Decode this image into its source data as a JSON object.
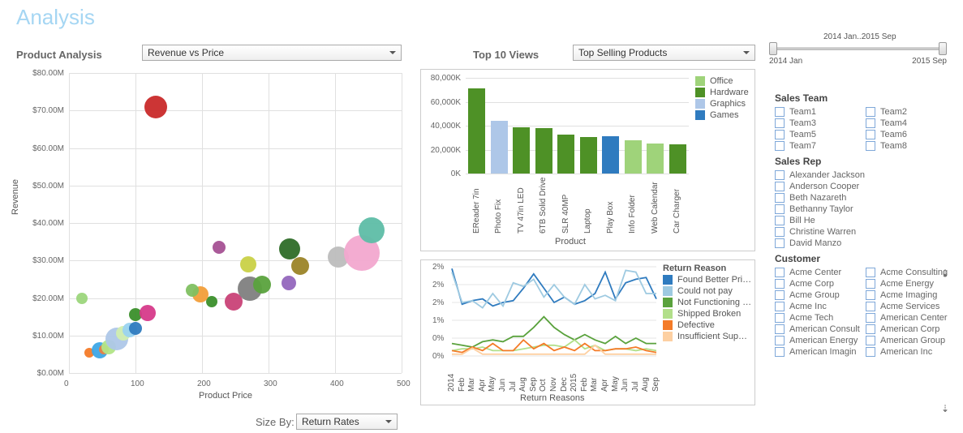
{
  "title": "Analysis",
  "dropdowns": {
    "product_analysis": {
      "label": "Product Analysis",
      "value": "Revenue vs Price"
    },
    "top10": {
      "label": "Top 10 Views",
      "value": "Top Selling Products"
    },
    "size_by": {
      "label": "Size By:",
      "value": "Return Rates"
    }
  },
  "chart_data": [
    {
      "id": "scatter",
      "type": "scatter",
      "title": "Revenue vs Price",
      "xlabel": "Product Price",
      "ylabel": "Revenue",
      "xlim": [
        0,
        500
      ],
      "ylim": [
        0,
        80
      ],
      "xticks": [
        0,
        100,
        200,
        300,
        400,
        500
      ],
      "yticks": [
        "$0.00M",
        "$10.00M",
        "$20.00M",
        "$30.00M",
        "$40.00M",
        "$50.00M",
        "$60.00M",
        "$70.00M",
        "$80.00M"
      ],
      "yvals": [
        0,
        10,
        20,
        30,
        40,
        50,
        60,
        70,
        80
      ],
      "bubbles": [
        {
          "x": 30,
          "y": 5.5,
          "r": 6,
          "c": "#f47b28"
        },
        {
          "x": 46,
          "y": 6.0,
          "r": 10,
          "c": "#3da6e6"
        },
        {
          "x": 52,
          "y": 6.3,
          "r": 6,
          "c": "#e87f43"
        },
        {
          "x": 60,
          "y": 7.0,
          "r": 9,
          "c": "#b2e587"
        },
        {
          "x": 72,
          "y": 9.0,
          "r": 14,
          "c": "#aec7e8"
        },
        {
          "x": 82,
          "y": 10.5,
          "r": 9,
          "c": "#d1edb0"
        },
        {
          "x": 92,
          "y": 11.5,
          "r": 9,
          "c": "#9ad3f0"
        },
        {
          "x": 100,
          "y": 12.0,
          "r": 8,
          "c": "#2f7bbf"
        },
        {
          "x": 100,
          "y": 15.5,
          "r": 8,
          "c": "#3b8f2b"
        },
        {
          "x": 20,
          "y": 20.0,
          "r": 7,
          "c": "#9cd67c"
        },
        {
          "x": 118,
          "y": 16.0,
          "r": 10,
          "c": "#d63a8a"
        },
        {
          "x": 130,
          "y": 71.0,
          "r": 14,
          "c": "#c92a2a"
        },
        {
          "x": 215,
          "y": 19.0,
          "r": 7,
          "c": "#3b8f2b"
        },
        {
          "x": 198,
          "y": 21.0,
          "r": 10,
          "c": "#f29e3a"
        },
        {
          "x": 185,
          "y": 22.0,
          "r": 8,
          "c": "#7fc061"
        },
        {
          "x": 226,
          "y": 33.5,
          "r": 8,
          "c": "#a55194"
        },
        {
          "x": 248,
          "y": 19.0,
          "r": 11,
          "c": "#c94277"
        },
        {
          "x": 272,
          "y": 22.5,
          "r": 15,
          "c": "#7f7f7f"
        },
        {
          "x": 270,
          "y": 29.0,
          "r": 10,
          "c": "#c9d147"
        },
        {
          "x": 290,
          "y": 23.5,
          "r": 11,
          "c": "#5aa23d"
        },
        {
          "x": 330,
          "y": 24.0,
          "r": 9,
          "c": "#9467bd"
        },
        {
          "x": 332,
          "y": 33.0,
          "r": 13,
          "c": "#2e6d28"
        },
        {
          "x": 348,
          "y": 28.5,
          "r": 11,
          "c": "#9b8428"
        },
        {
          "x": 405,
          "y": 31.0,
          "r": 13,
          "c": "#bdbdbd"
        },
        {
          "x": 440,
          "y": 32.0,
          "r": 22,
          "c": "#f2a8cf"
        },
        {
          "x": 455,
          "y": 38.0,
          "r": 16,
          "c": "#5ebda7"
        }
      ]
    },
    {
      "id": "top_products",
      "type": "bar",
      "xlabel": "Product",
      "categories": [
        "EReader 7in",
        "Photo Fix",
        "TV 47in LED",
        "6TB Solid Drive",
        "SLR 40MP",
        "Laptop",
        "Play Box",
        "Info Folder",
        "Web Calendar",
        "Car Charger"
      ],
      "values": [
        71000,
        44000,
        38500,
        38000,
        32500,
        30500,
        31000,
        27500,
        25000,
        24500
      ],
      "colors": [
        "#4e9126",
        "#aec7e8",
        "#4e9126",
        "#4e9126",
        "#4e9126",
        "#4e9126",
        "#2f7bbf",
        "#9fd37a",
        "#9fd37a",
        "#4e9126"
      ],
      "ylim": [
        0,
        80000
      ],
      "yticks": [
        "0K",
        "20,000K",
        "40,000K",
        "60,000K",
        "80,000K"
      ],
      "yvals": [
        0,
        20000,
        40000,
        60000,
        80000
      ],
      "legend": [
        [
          "Office",
          "#9fd37a"
        ],
        [
          "Hardware",
          "#4e9126"
        ],
        [
          "Graphics",
          "#aec7e8"
        ],
        [
          "Games",
          "#2f7bbf"
        ]
      ]
    },
    {
      "id": "returns",
      "type": "line",
      "title": "Return Reasons",
      "legend_title": "Return Reason",
      "xlabel": "Return Reasons",
      "categories": [
        "2014",
        "Feb",
        "Mar",
        "Apr",
        "May",
        "Jun",
        "Jul",
        "Aug",
        "Sep",
        "Oct",
        "Nov",
        "Dec",
        "2015",
        "Feb",
        "Mar",
        "Apr",
        "May",
        "Jun",
        "Jul",
        "Aug",
        "Sep"
      ],
      "yticks": [
        "0%",
        "0%",
        "1%",
        "2%",
        "2%",
        "2%"
      ],
      "yvals": [
        0,
        0.4,
        1,
        1.6,
        2,
        2.4
      ],
      "series": [
        {
          "name": "Found Better Pri…",
          "c": "#2f7bbf",
          "v": [
            2.45,
            1.45,
            1.55,
            1.6,
            1.4,
            1.5,
            1.55,
            1.9,
            2.3,
            1.9,
            1.5,
            1.65,
            1.45,
            1.55,
            1.75,
            2.35,
            1.6,
            2.05,
            2.15,
            2.2,
            1.6
          ]
        },
        {
          "name": "Could not pay",
          "c": "#9ecae1",
          "v": [
            2.35,
            1.5,
            1.55,
            1.35,
            1.75,
            1.4,
            2.05,
            1.95,
            2.15,
            1.65,
            2.0,
            1.65,
            1.45,
            2.0,
            1.6,
            1.7,
            1.55,
            2.4,
            2.35,
            1.75,
            1.75
          ]
        },
        {
          "name": "Not Functioning …",
          "c": "#5aa23d",
          "v": [
            0.35,
            0.3,
            0.25,
            0.4,
            0.45,
            0.4,
            0.55,
            0.55,
            0.8,
            1.1,
            0.8,
            0.6,
            0.45,
            0.6,
            0.45,
            0.35,
            0.55,
            0.35,
            0.5,
            0.35,
            0.35
          ]
        },
        {
          "name": "Shipped Broken",
          "c": "#b2df8a",
          "v": [
            0.15,
            0.2,
            0.2,
            0.25,
            0.15,
            0.15,
            0.15,
            0.2,
            0.25,
            0.3,
            0.3,
            0.25,
            0.45,
            0.2,
            0.3,
            0.15,
            0.2,
            0.2,
            0.15,
            0.2,
            0.15
          ]
        },
        {
          "name": "Defective",
          "c": "#f47b28",
          "v": [
            0.15,
            0.1,
            0.25,
            0.15,
            0.35,
            0.15,
            0.15,
            0.45,
            0.2,
            0.35,
            0.15,
            0.25,
            0.15,
            0.35,
            0.15,
            0.15,
            0.2,
            0.2,
            0.25,
            0.15,
            0.1
          ]
        },
        {
          "name": "Insufficient Sup…",
          "c": "#fdd0a2",
          "v": [
            0.05,
            0.05,
            0.22,
            0.05,
            0.05,
            0.05,
            0.05,
            0.05,
            0.05,
            0.05,
            0.05,
            0.05,
            0.05,
            0.05,
            0.3,
            0.05,
            0.05,
            0.05,
            0.05,
            0.05,
            0.05
          ]
        }
      ]
    }
  ],
  "time_slider": {
    "label": "2014 Jan..2015 Sep",
    "min": "2014 Jan",
    "max": "2015 Sep"
  },
  "filters": {
    "sales_team": {
      "title": "Sales Team",
      "items": [
        "Team1",
        "Team2",
        "Team3",
        "Team4",
        "Team5",
        "Team6",
        "Team7",
        "Team8"
      ]
    },
    "sales_rep": {
      "title": "Sales Rep",
      "items": [
        "Alexander Jackson",
        "Anderson Cooper",
        "Beth Nazareth",
        "Bethanny Taylor",
        "Bill He",
        "Christine Warren",
        "David Manzo"
      ]
    },
    "customer": {
      "title": "Customer",
      "items": [
        "Acme Center",
        "Acme Consulting",
        "Acme Corp",
        "Acme Energy",
        "Acme Group",
        "Acme Imaging",
        "Acme Inc",
        "Acme Services",
        "Acme Tech",
        "American Center",
        "American Consult",
        "American Corp",
        "American Energy",
        "American Group",
        "American Imagin",
        "American Inc"
      ]
    }
  }
}
